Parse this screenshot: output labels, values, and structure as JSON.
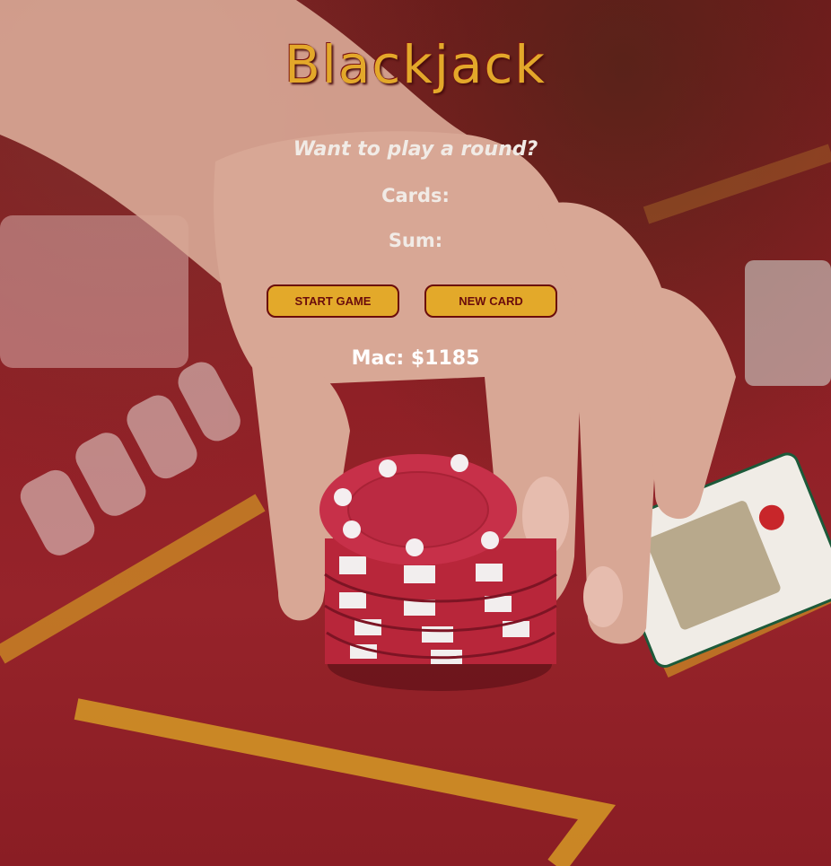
{
  "game": {
    "title": "Blackjack",
    "message": "Want to play a round?",
    "cards_label": "Cards:",
    "sum_label": "Sum:",
    "start_button_label": "START GAME",
    "new_card_button_label": "NEW CARD",
    "player_info": "Mac: $1185"
  },
  "colors": {
    "accent_gold": "#e3a92a",
    "button_text": "#6a0c0c",
    "felt_red": "#8c1f24",
    "text_light": "#f1ebe6"
  },
  "background_image": {
    "subject": "hand placing a stack of red casino chips on a blackjack table"
  }
}
